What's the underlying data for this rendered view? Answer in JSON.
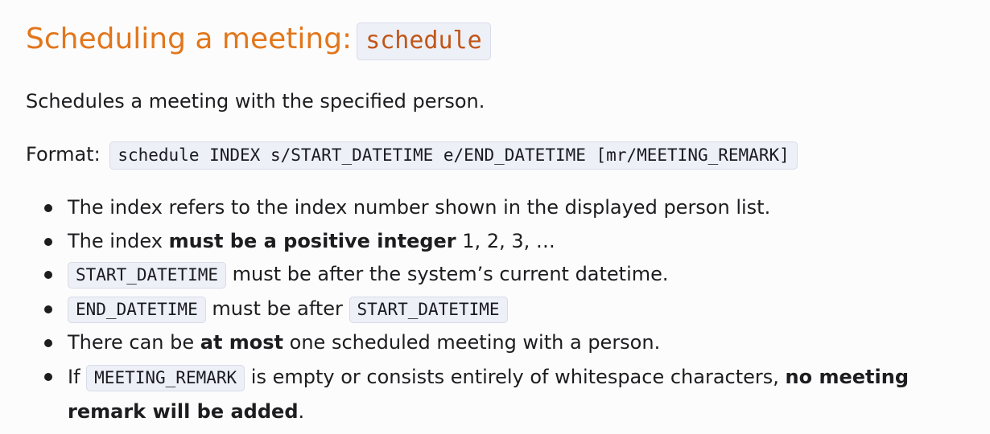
{
  "title": {
    "text": "Scheduling a meeting:",
    "command": "schedule"
  },
  "description": "Schedules a meeting with the specified person.",
  "format": {
    "label": "Format:",
    "syntax": "schedule INDEX s/START_DATETIME e/END_DATETIME [mr/MEETING_REMARK]"
  },
  "rules": [
    {
      "text": "The index refers to the index number shown in the displayed person list."
    },
    {
      "prefix": "The index ",
      "bold": "must be a positive integer",
      "suffix": " 1, 2, 3, …"
    },
    {
      "code": "START_DATETIME",
      "suffix": " must be after the system’s current datetime."
    },
    {
      "code": "END_DATETIME",
      "middle": " must be after ",
      "code2": "START_DATETIME"
    },
    {
      "prefix": "There can be ",
      "bold": "at most",
      "suffix": " one scheduled meeting with a person."
    },
    {
      "prefix": "If ",
      "code": "MEETING_REMARK",
      "middle": " is empty or consists entirely of whitespace characters, ",
      "bold": "no meeting remark will be added",
      "suffix": "."
    }
  ]
}
